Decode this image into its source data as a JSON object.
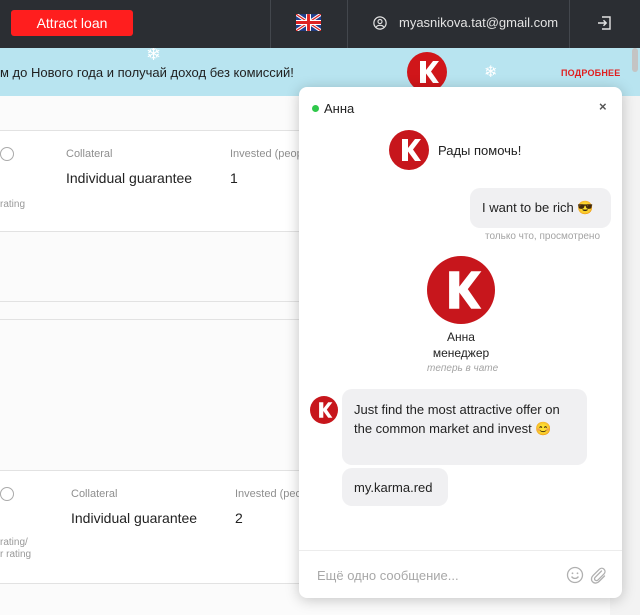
{
  "topbar": {
    "attract_label": "Attract loan",
    "language_icon": "uk-flag-icon",
    "email": "myasnikova.tat@gmail.com",
    "logout_icon": "logout-icon"
  },
  "banner": {
    "text": "м до Нового года и получай доход без комиссий!",
    "more": "ПОДРОБНЕЕ"
  },
  "cards": [
    {
      "collateral_header": "Collateral",
      "collateral_value": "Individual guarantee",
      "invested_header": "Invested (peop",
      "invested_value": "1",
      "rating_label": "rating"
    },
    {
      "collateral_header": "Collateral",
      "collateral_value": "Individual guarantee",
      "invested_header": "Invested (peo",
      "invested_value": "2",
      "rating_label_1": "rating/",
      "rating_label_2": "r rating"
    }
  ],
  "chat": {
    "agent_name": "Анна",
    "close": "×",
    "messages": {
      "greeting": "Рады помочь!",
      "user_msg": "I want to be rich 😎",
      "user_status": "только что, просмотрено",
      "manager_name": "Анна",
      "manager_role": "менеджер",
      "manager_status": "теперь в чате",
      "reply_1": "Just find the most attractive offer on the common market and invest 😊",
      "reply_2": "my.karma.red"
    },
    "input_placeholder": "Ещё одно сообщение...",
    "colors": {
      "brand": "#c7161c",
      "online": "#2fc84b"
    }
  }
}
